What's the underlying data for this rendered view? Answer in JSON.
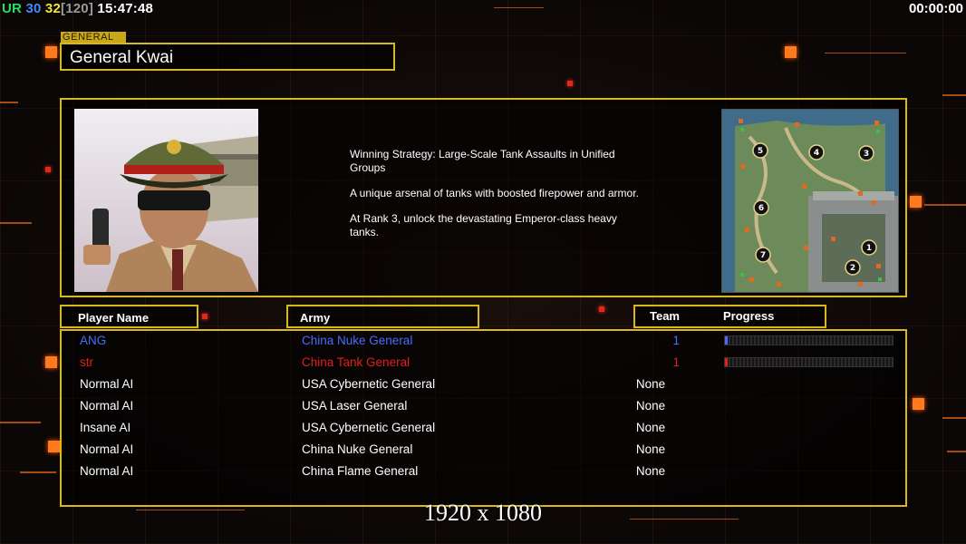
{
  "hud": {
    "ur_label": "UR",
    "fps_a": "30",
    "fps_b": "32",
    "fps_cap": "[120]",
    "clock": "15:47:48",
    "game_timer": "00:00:00"
  },
  "general": {
    "tag": "GENERAL",
    "name": "General Kwai",
    "description": [
      "Winning Strategy: Large-Scale Tank Assaults in Unified Groups",
      "A unique arsenal of tanks with boosted firepower and armor.",
      "At Rank 3, unlock the devastating Emperor-class heavy tanks."
    ]
  },
  "minimap": {
    "start_positions": [
      "5",
      "4",
      "3",
      "6",
      "1",
      "7",
      "2"
    ]
  },
  "table": {
    "headers": {
      "player": "Player Name",
      "army": "Army",
      "team": "Team",
      "progress": "Progress"
    },
    "rows": [
      {
        "name": "ANG",
        "army": "China Nuke General",
        "team": "1",
        "color": "#4a6bff",
        "progress": 0.01
      },
      {
        "name": "str",
        "army": "China Tank General",
        "team": "1",
        "color": "#e0201a",
        "progress": 0.01
      },
      {
        "name": "Normal AI",
        "army": "USA Cybernetic General",
        "team": "None",
        "color": "#ffffff"
      },
      {
        "name": "Normal AI",
        "army": "USA Laser General",
        "team": "None",
        "color": "#ffffff"
      },
      {
        "name": "Insane AI",
        "army": "USA Cybernetic General",
        "team": "None",
        "color": "#ffffff"
      },
      {
        "name": "Normal AI",
        "army": "China Nuke General",
        "team": "None",
        "color": "#ffffff"
      },
      {
        "name": "Normal AI",
        "army": "China Flame General",
        "team": "None",
        "color": "#ffffff"
      }
    ]
  },
  "resolution_label": "1920 x 1080",
  "colors": {
    "frame": "#d8b81a",
    "accent": "#ff7a1f"
  }
}
